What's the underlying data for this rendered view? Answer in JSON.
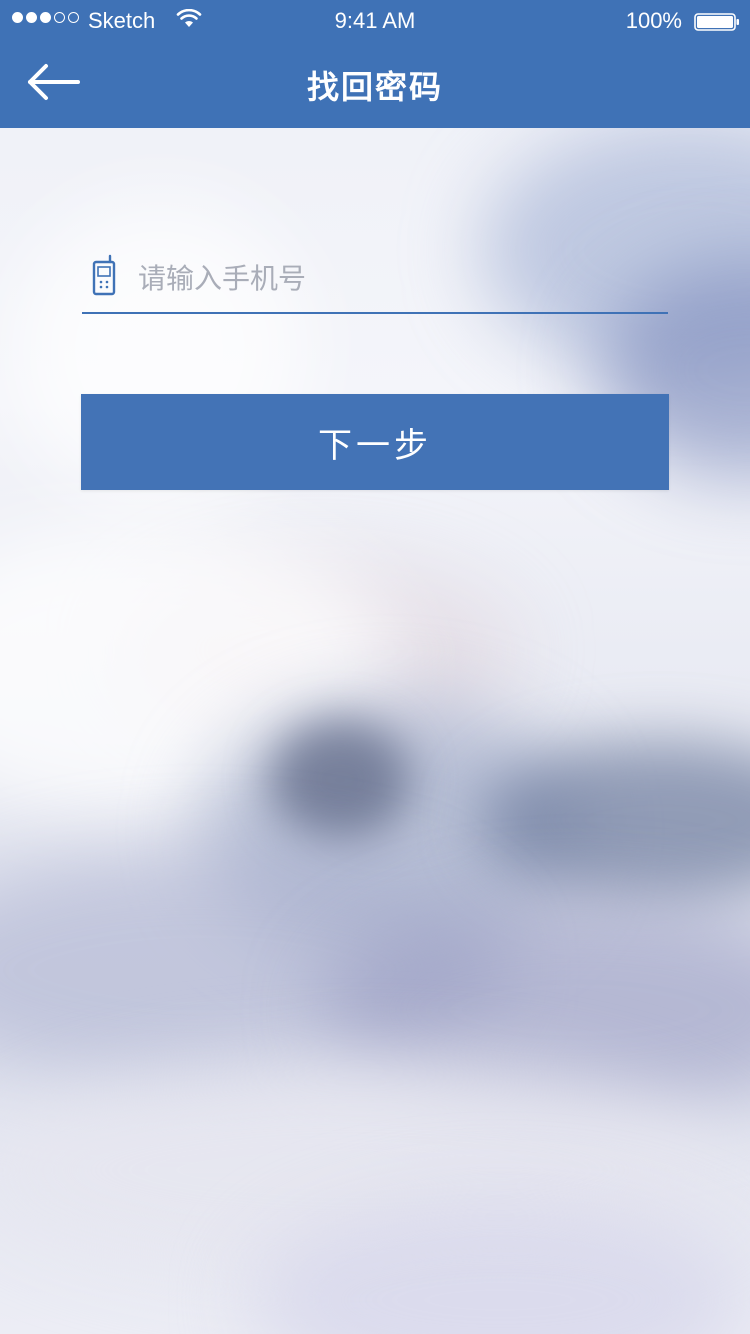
{
  "status_bar": {
    "carrier": "Sketch",
    "time": "9:41 AM",
    "battery_percent": "100%"
  },
  "nav": {
    "title": "找回密码",
    "back_icon": "arrow-left-icon"
  },
  "form": {
    "phone_field": {
      "icon": "mobile-phone-icon",
      "placeholder": "请输入手机号",
      "value": ""
    },
    "next_button_label": "下一步"
  },
  "colors": {
    "brand_blue": "#3f72b6",
    "button_blue": "#4373b6",
    "placeholder_gray": "#a9adb8"
  }
}
